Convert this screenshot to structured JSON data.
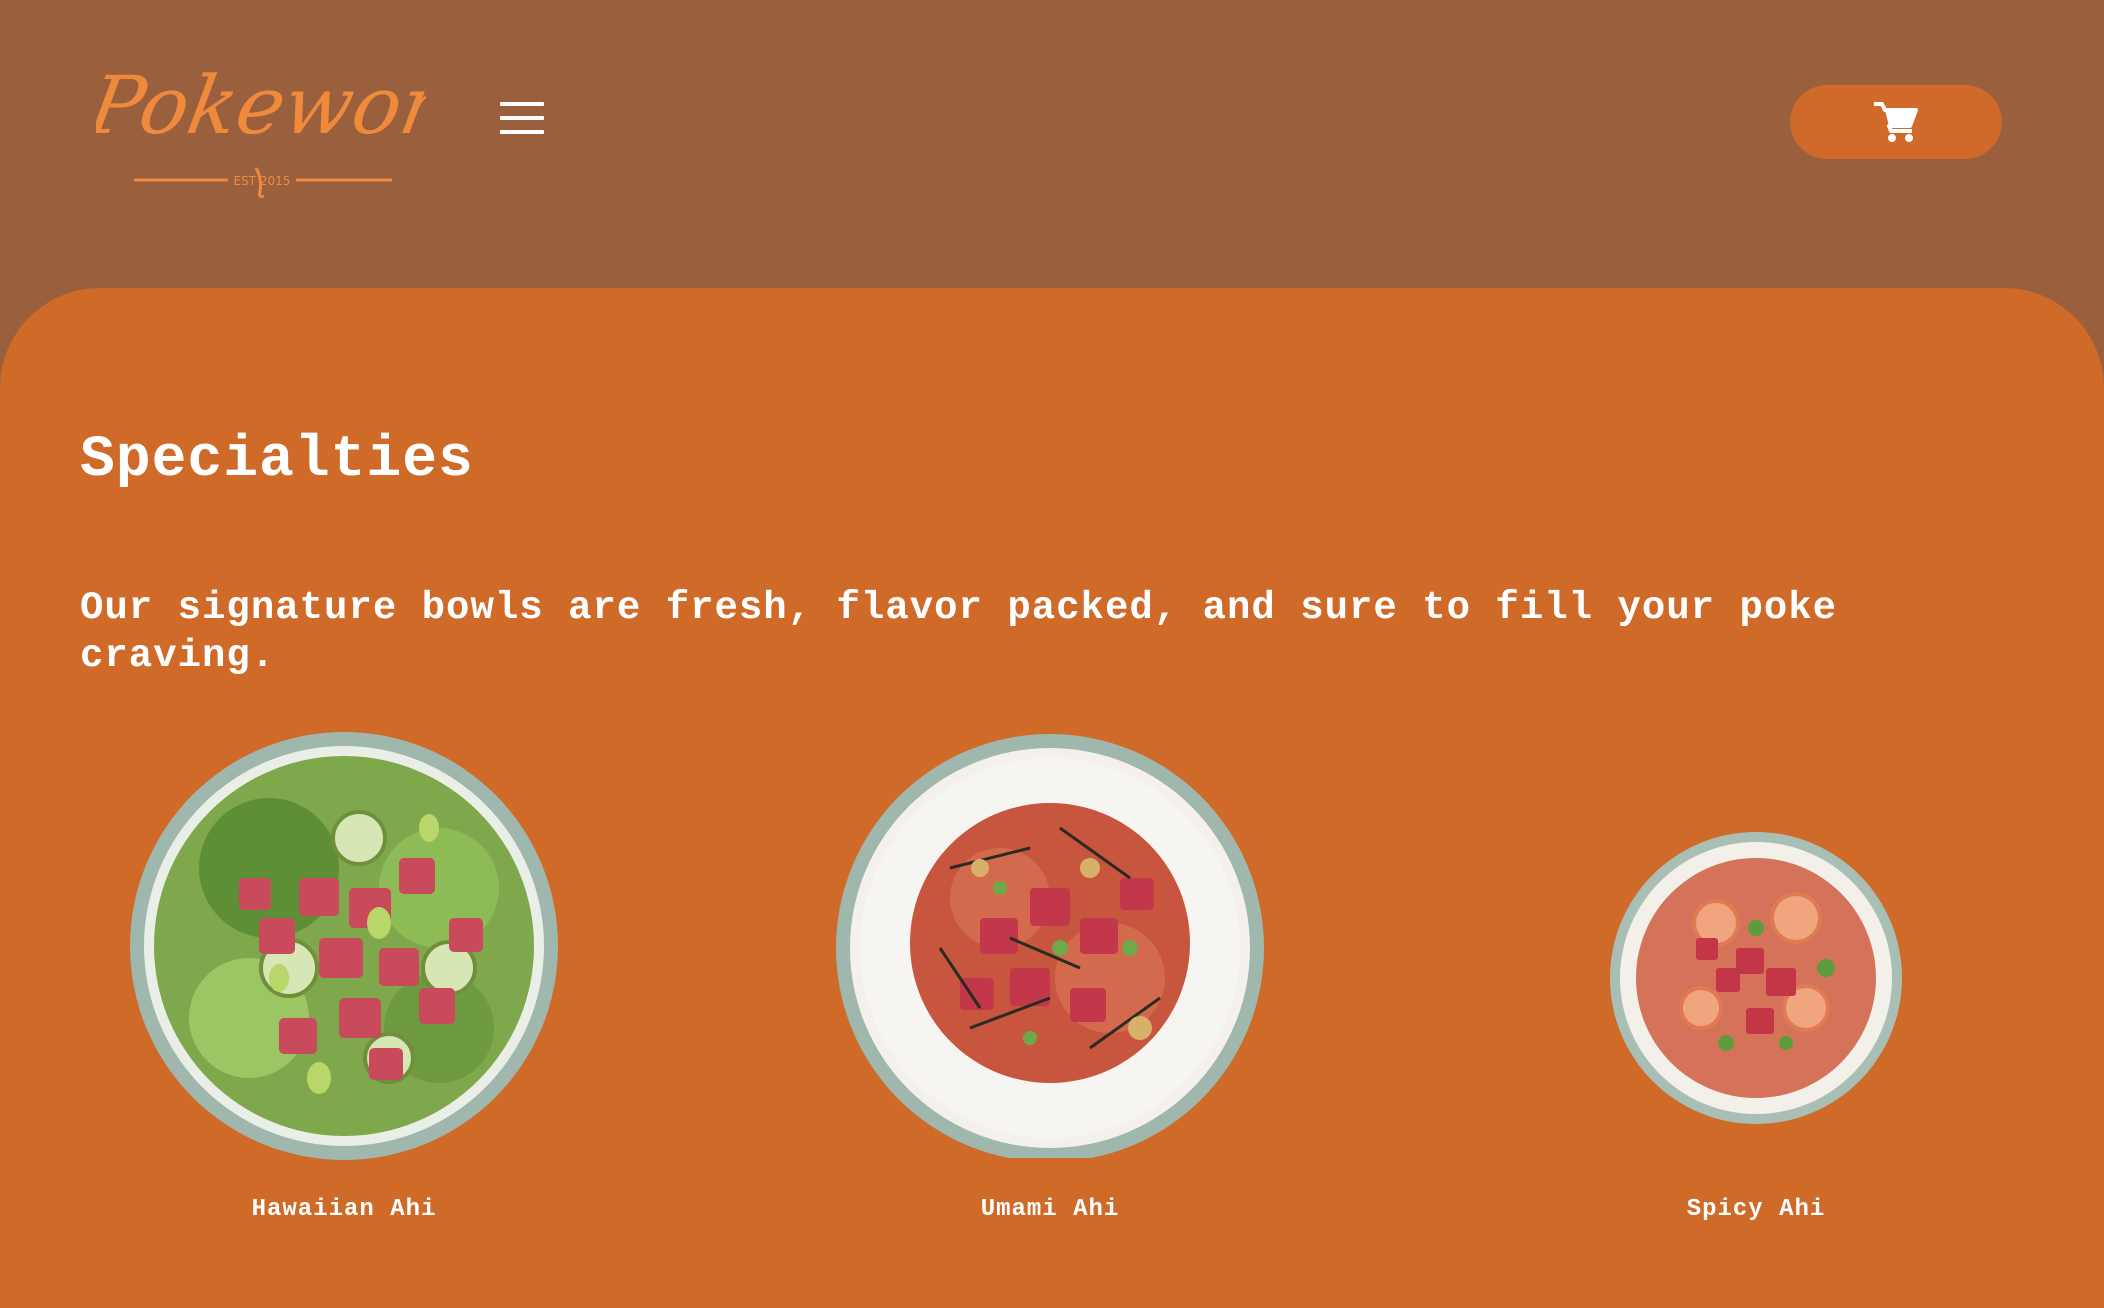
{
  "header": {
    "logo_text": "Pokeworks",
    "logo_tagline": "EST 2015",
    "menu_icon": "hamburger-menu-icon",
    "cart_icon": "shopping-cart-icon"
  },
  "specialties": {
    "title": "Specialties",
    "description": "Our signature bowls are fresh, flavor packed, and sure to fill your poke craving."
  },
  "bowls": [
    {
      "name": "Hawaiian Ahi"
    },
    {
      "name": "Umami Ahi"
    },
    {
      "name": "Spicy Ahi"
    }
  ],
  "colors": {
    "header_bg": "#9a5f3c",
    "main_bg": "#cf6a29",
    "cart_button_bg": "#d0692a",
    "logo_orange": "#ef8a3c",
    "text": "#ffffff"
  }
}
